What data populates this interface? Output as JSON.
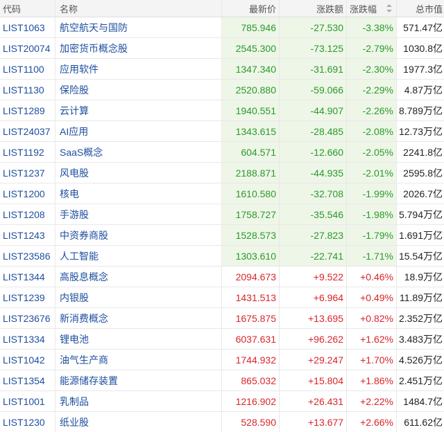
{
  "header": {
    "code": "代码",
    "name": "名称",
    "price": "最新价",
    "change": "涨跌额",
    "pct": "涨跌幅",
    "cap": "总市值"
  },
  "rows": [
    {
      "code": "LIST1063",
      "name": "航空航天与国防",
      "price": "785.946",
      "change": "-27.530",
      "pct": "-3.38%",
      "cap": "571.47亿",
      "dir": "down"
    },
    {
      "code": "LIST20074",
      "name": "加密货币概念股",
      "price": "2545.300",
      "change": "-73.125",
      "pct": "-2.79%",
      "cap": "1030.8亿",
      "dir": "down"
    },
    {
      "code": "LIST1100",
      "name": "应用软件",
      "price": "1347.340",
      "change": "-31.691",
      "pct": "-2.30%",
      "cap": "1977.3亿",
      "dir": "down"
    },
    {
      "code": "LIST1130",
      "name": "保险股",
      "price": "2520.880",
      "change": "-59.066",
      "pct": "-2.29%",
      "cap": "4.87万亿",
      "dir": "down"
    },
    {
      "code": "LIST1289",
      "name": "云计算",
      "price": "1940.551",
      "change": "-44.907",
      "pct": "-2.26%",
      "cap": "8.789万亿",
      "dir": "down"
    },
    {
      "code": "LIST24037",
      "name": "AI应用",
      "price": "1343.615",
      "change": "-28.485",
      "pct": "-2.08%",
      "cap": "12.73万亿",
      "dir": "down"
    },
    {
      "code": "LIST1192",
      "name": "SaaS概念",
      "price": "604.571",
      "change": "-12.660",
      "pct": "-2.05%",
      "cap": "2241.8亿",
      "dir": "down"
    },
    {
      "code": "LIST1237",
      "name": "风电股",
      "price": "2188.871",
      "change": "-44.935",
      "pct": "-2.01%",
      "cap": "2595.8亿",
      "dir": "down"
    },
    {
      "code": "LIST1200",
      "name": "核电",
      "price": "1610.580",
      "change": "-32.708",
      "pct": "-1.99%",
      "cap": "2026.7亿",
      "dir": "down"
    },
    {
      "code": "LIST1208",
      "name": "手游股",
      "price": "1758.727",
      "change": "-35.546",
      "pct": "-1.98%",
      "cap": "5.794万亿",
      "dir": "down"
    },
    {
      "code": "LIST1243",
      "name": "中资券商股",
      "price": "1528.573",
      "change": "-27.823",
      "pct": "-1.79%",
      "cap": "1.691万亿",
      "dir": "down"
    },
    {
      "code": "LIST23586",
      "name": "人工智能",
      "price": "1303.610",
      "change": "-22.741",
      "pct": "-1.71%",
      "cap": "15.54万亿",
      "dir": "down"
    },
    {
      "code": "LIST1344",
      "name": "高股息概念",
      "price": "2094.673",
      "change": "+9.522",
      "pct": "+0.46%",
      "cap": "18.9万亿",
      "dir": "up"
    },
    {
      "code": "LIST1239",
      "name": "内银股",
      "price": "1431.513",
      "change": "+6.964",
      "pct": "+0.49%",
      "cap": "11.89万亿",
      "dir": "up"
    },
    {
      "code": "LIST23676",
      "name": "新消费概念",
      "price": "1675.875",
      "change": "+13.695",
      "pct": "+0.82%",
      "cap": "2.352万亿",
      "dir": "up"
    },
    {
      "code": "LIST1334",
      "name": "锂电池",
      "price": "6037.631",
      "change": "+96.262",
      "pct": "+1.62%",
      "cap": "3.483万亿",
      "dir": "up"
    },
    {
      "code": "LIST1042",
      "name": "油气生产商",
      "price": "1744.932",
      "change": "+29.247",
      "pct": "+1.70%",
      "cap": "4.526万亿",
      "dir": "up"
    },
    {
      "code": "LIST1354",
      "name": "能源储存装置",
      "price": "865.032",
      "change": "+15.804",
      "pct": "+1.86%",
      "cap": "2.451万亿",
      "dir": "up"
    },
    {
      "code": "LIST1001",
      "name": "乳制品",
      "price": "1216.902",
      "change": "+26.431",
      "pct": "+2.22%",
      "cap": "1484.7亿",
      "dir": "up"
    },
    {
      "code": "LIST1230",
      "name": "纸业股",
      "price": "528.590",
      "change": "+13.677",
      "pct": "+2.66%",
      "cap": "611.62亿",
      "dir": "up"
    }
  ]
}
